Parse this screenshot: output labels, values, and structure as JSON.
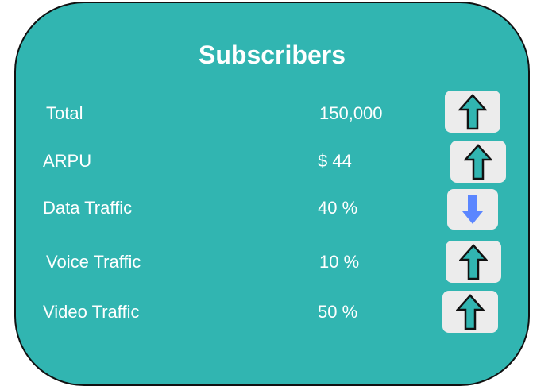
{
  "title": "Subscribers",
  "colors": {
    "card_background": "#31b5b1",
    "card_border": "#111111",
    "text": "#ffffff",
    "button_background": "#ececec",
    "up_arrow": "#31b5b1",
    "down_arrow": "#5b86ff"
  },
  "rows": [
    {
      "label": "Total",
      "value": "150,000",
      "trend_icon": "up-arrow-icon"
    },
    {
      "label": "ARPU",
      "value": "$ 44",
      "trend_icon": "up-arrow-icon"
    },
    {
      "label": "Data Traffic",
      "value": "40 %",
      "trend_icon": "down-arrow-icon"
    },
    {
      "label": "Voice Traffic",
      "value": "10 %",
      "trend_icon": "up-arrow-icon"
    },
    {
      "label": "Video Traffic",
      "value": "50 %",
      "trend_icon": "up-arrow-icon"
    }
  ]
}
